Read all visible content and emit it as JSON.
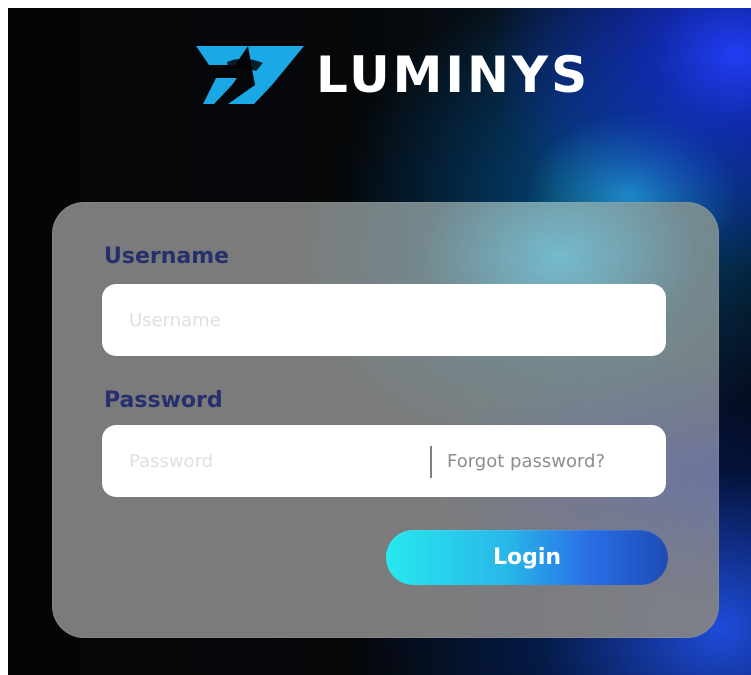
{
  "brand": {
    "name": "LUMINYS",
    "logo_icon": "luminys-logo-icon",
    "logo_color": "#1ba8e7"
  },
  "login_form": {
    "username": {
      "label": "Username",
      "placeholder": "Username",
      "value": ""
    },
    "password": {
      "label": "Password",
      "placeholder": "Password",
      "value": ""
    },
    "forgot_password": "Forgot password?",
    "submit_label": "Login"
  },
  "colors": {
    "card": "#848484",
    "label": "#26306d",
    "button_start": "#28e8ef",
    "button_end": "#1e4bb4"
  }
}
